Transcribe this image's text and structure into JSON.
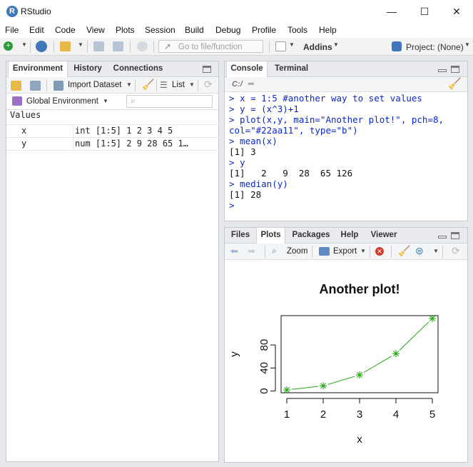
{
  "window": {
    "title": "RStudio",
    "minimize": "—",
    "maximize": "☐",
    "close": "✕"
  },
  "menu": [
    "File",
    "Edit",
    "Code",
    "View",
    "Plots",
    "Session",
    "Build",
    "Debug",
    "Profile",
    "Tools",
    "Help"
  ],
  "toolbar": {
    "goto_placeholder": "Go to file/function",
    "addins": "Addins",
    "project": "Project: (None)"
  },
  "env": {
    "tabs": [
      "Environment",
      "History",
      "Connections"
    ],
    "import_dataset": "Import Dataset",
    "list_view": "List",
    "scope": "Global Environment",
    "values_header": "Values",
    "rows": [
      {
        "name": "x",
        "value": "int [1:5] 1 2 3 4 5"
      },
      {
        "name": "y",
        "value": "num [1:5] 2 9 28 65 1…"
      }
    ]
  },
  "console": {
    "tabs": [
      "Console",
      "Terminal"
    ],
    "path": "C:/",
    "lines": [
      {
        "kind": "in",
        "text": "> x = 1:5 #another way to set values"
      },
      {
        "kind": "in",
        "text": "> y = (x^3)+1"
      },
      {
        "kind": "in",
        "text": "> plot(x,y, main=\"Another plot!\", pch=8,"
      },
      {
        "kind": "in",
        "text": "col=\"#22aa11\", type=\"b\")"
      },
      {
        "kind": "in",
        "text": "> mean(x)"
      },
      {
        "kind": "out",
        "text": "[1] 3"
      },
      {
        "kind": "in",
        "text": "> y"
      },
      {
        "kind": "out",
        "text": "[1]   2   9  28  65 126"
      },
      {
        "kind": "in",
        "text": "> median(y)"
      },
      {
        "kind": "out",
        "text": "[1] 28"
      },
      {
        "kind": "in",
        "text": ">"
      }
    ]
  },
  "plots_pane": {
    "tabs": [
      "Files",
      "Plots",
      "Packages",
      "Help",
      "Viewer"
    ],
    "zoom": "Zoom",
    "export": "Export"
  },
  "chart_data": {
    "type": "line",
    "title": "Another plot!",
    "xlabel": "x",
    "ylabel": "y",
    "x": [
      1,
      2,
      3,
      4,
      5
    ],
    "y": [
      2,
      9,
      28,
      65,
      126
    ],
    "xticks": [
      "1",
      "2",
      "3",
      "4",
      "5"
    ],
    "yticks": [
      "0",
      "40",
      "80"
    ],
    "color": "#22aa11",
    "marker": "asterisk",
    "plot_type": "both points and lines",
    "xlim": [
      1,
      5
    ],
    "ylim": [
      2,
      126
    ]
  },
  "colors": {
    "accent": "#3f77b9",
    "input_text": "#0b28c8",
    "series": "#22aa11"
  }
}
